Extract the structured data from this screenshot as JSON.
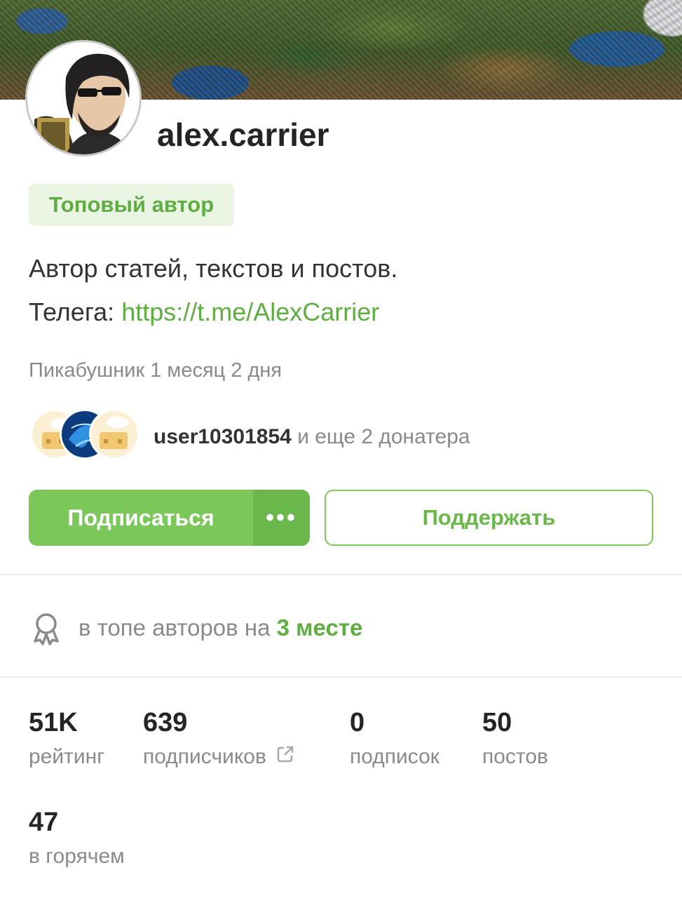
{
  "profile": {
    "username": "alex.carrier",
    "badge": "Топовый автор",
    "bio_line1": "Автор статей, текстов и постов.",
    "bio_line2_prefix": "Телега: ",
    "bio_link": "https://t.me/AlexCarrier",
    "tenure": "Пикабушник 1 месяц 2 дня"
  },
  "donors": {
    "user": "user10301854",
    "rest": " и еще 2 донатера"
  },
  "actions": {
    "subscribe_label": "Подписаться",
    "more_label": "•••",
    "support_label": "Поддержать"
  },
  "top_rank": {
    "prefix": "в топе авторов на ",
    "place": "3 месте"
  },
  "stats": [
    {
      "value": "51K",
      "label": "рейтинг"
    },
    {
      "value": "639",
      "label": "подписчиков"
    },
    {
      "value": "0",
      "label": "подписок"
    },
    {
      "value": "50",
      "label": "постов"
    },
    {
      "value": "47",
      "label": "в горячем"
    }
  ],
  "colors": {
    "accent": "#7bc75a",
    "accent_dark": "#5fae42",
    "badge_bg": "#eaf6e3",
    "muted": "#8a8a8a"
  }
}
